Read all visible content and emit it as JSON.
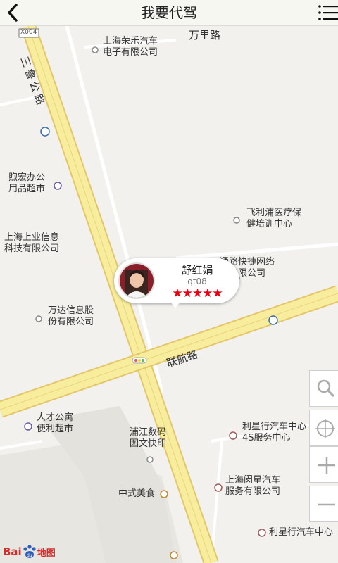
{
  "header": {
    "title": "我要代驾",
    "back_icon": "chevron-left-icon",
    "menu_icon": "menu-list-icon"
  },
  "map": {
    "roads": {
      "sanlu": "三鲁公路",
      "lianhang": "联航路",
      "wanfang": "万里路",
      "x004": "X004"
    },
    "pois": {
      "rongle": "上海荣乐汽车\n电子有限公司",
      "xuhong": "煦宏办公\n用品超市",
      "shangye": "上海上业信息\n科技有限公司",
      "philips": "飞利浦医疗保\n健培训中心",
      "express": "通路快捷网络\n包有限公司",
      "wanda": "万达信息股\n份有限公司",
      "rencai": "人才公寓\n便利超市",
      "pujiang": "浦江数码\n图文快印",
      "lixing1": "利星行汽车中心\n4S服务中心",
      "minxing": "上海闵星汽车\n服务有限公司",
      "zhongshi": "中式美食",
      "lixing2": "利星行汽车中心"
    }
  },
  "driver": {
    "name": "舒红娟",
    "id": "qt08",
    "rating": "★★★★★",
    "rating_value": 5
  },
  "controls": {
    "search": "search-icon",
    "locate": "locate-icon",
    "zoom_in": "+",
    "zoom_out": "−"
  },
  "logo": {
    "brand": "Bai",
    "suffix": "地图"
  },
  "colors": {
    "road_fill": "#f7ed9c",
    "road_edge": "#e3c76a",
    "star": "#e60012"
  }
}
